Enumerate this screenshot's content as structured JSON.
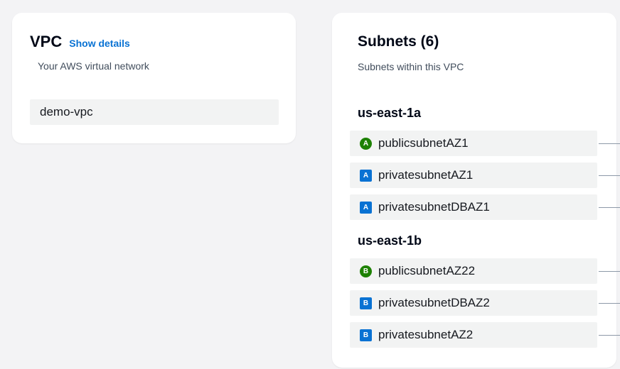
{
  "vpc": {
    "title": "VPC",
    "details_link": "Show details",
    "subtitle": "Your AWS virtual network",
    "name": "demo-vpc"
  },
  "subnets": {
    "title": "Subnets (6)",
    "subtitle": "Subnets within this VPC",
    "zones": [
      {
        "label": "us-east-1a",
        "items": [
          {
            "badge": "A",
            "type": "public",
            "name": "publicsubnetAZ1"
          },
          {
            "badge": "A",
            "type": "private",
            "name": "privatesubnetAZ1"
          },
          {
            "badge": "A",
            "type": "private",
            "name": "privatesubnetDBAZ1"
          }
        ]
      },
      {
        "label": "us-east-1b",
        "items": [
          {
            "badge": "B",
            "type": "public",
            "name": "publicsubnetAZ22"
          },
          {
            "badge": "B",
            "type": "private",
            "name": "privatesubnetDBAZ2"
          },
          {
            "badge": "B",
            "type": "private",
            "name": "privatesubnetAZ2"
          }
        ]
      }
    ]
  },
  "colors": {
    "public_badge": "#1d8102",
    "private_badge": "#0972d3",
    "link": "#0972d3",
    "row_background": "#f2f3f3",
    "page_background": "#f3f3f5"
  }
}
